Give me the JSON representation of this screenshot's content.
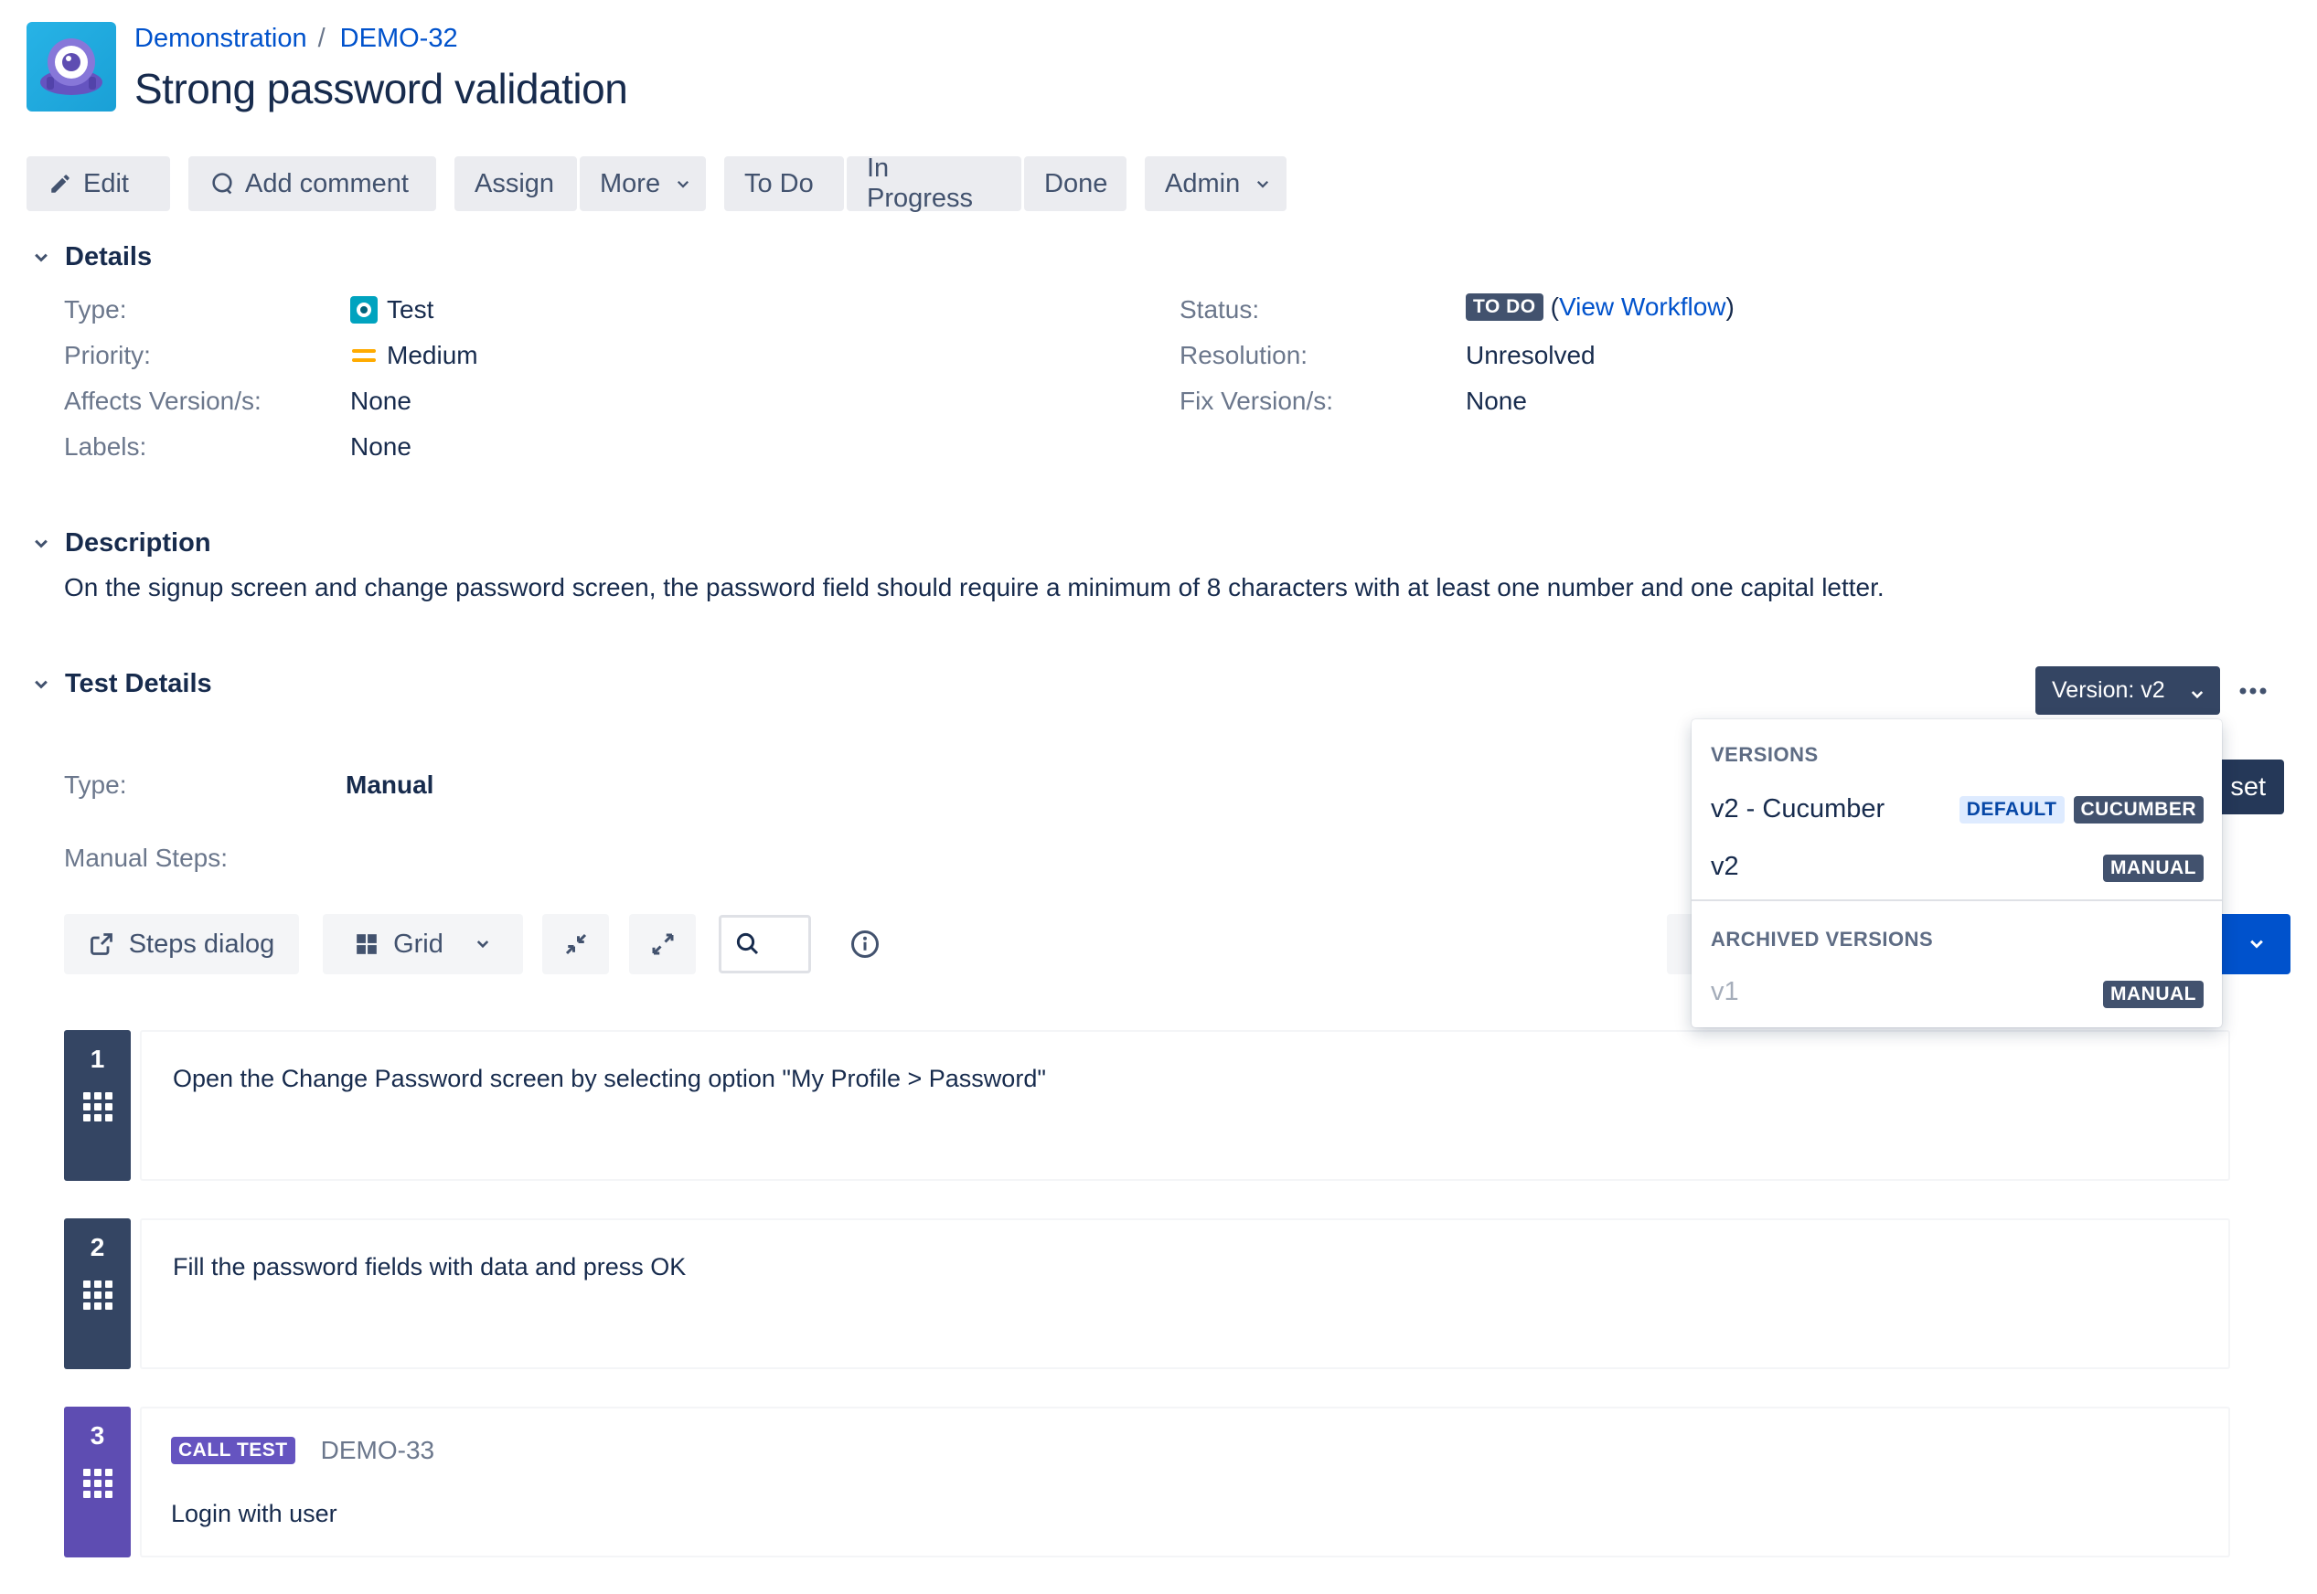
{
  "breadcrumb": {
    "project": "Demonstration",
    "separator": "/",
    "issue_key": "DEMO-32"
  },
  "title": "Strong password validation",
  "toolbar": {
    "edit": "Edit",
    "add_comment": "Add comment",
    "assign": "Assign",
    "more": "More",
    "to_do": "To Do",
    "in_progress": "In Progress",
    "done": "Done",
    "admin": "Admin"
  },
  "details": {
    "heading": "Details",
    "type_label": "Type:",
    "type_value": "Test",
    "priority_label": "Priority:",
    "priority_value": "Medium",
    "affects_label": "Affects Version/s:",
    "affects_value": "None",
    "labels_label": "Labels:",
    "labels_value": "None",
    "status_label": "Status:",
    "status_value": "TO DO",
    "workflow_open": "(",
    "workflow_link": "View Workflow",
    "workflow_close": ")",
    "resolution_label": "Resolution:",
    "resolution_value": "Unresolved",
    "fix_label": "Fix Version/s:",
    "fix_value": "None"
  },
  "description": {
    "heading": "Description",
    "text": "On the signup screen and change password screen, the password field should require a minimum of 8 characters with at least one number and one capital letter."
  },
  "test_details": {
    "heading": "Test Details",
    "version_button": "Version: v2",
    "type_label": "Type:",
    "type_value": "Manual",
    "manual_steps_label": "Manual Steps:",
    "reset_partial": "set",
    "steps_dialog": "Steps dialog",
    "grid": "Grid"
  },
  "versions_dropdown": {
    "versions_heading": "VERSIONS",
    "items": [
      {
        "label": "v2 - Cucumber",
        "badges": [
          "DEFAULT",
          "CUCUMBER"
        ]
      },
      {
        "label": "v2",
        "badges": [
          "MANUAL"
        ]
      }
    ],
    "archived_heading": "ARCHIVED VERSIONS",
    "archived": [
      {
        "label": "v1",
        "badges": [
          "MANUAL"
        ]
      }
    ]
  },
  "steps": [
    {
      "number": "1",
      "text": "Open the Change Password screen by selecting option \"My Profile > Password\""
    },
    {
      "number": "2",
      "text": "Fill the password fields with data and press OK"
    },
    {
      "number": "3",
      "badge": "CALL TEST",
      "key": "DEMO-33",
      "text": "Login with user"
    }
  ],
  "colors": {
    "primary_blue": "#0052cc",
    "dark_navy": "#344563",
    "purple": "#5e4db2",
    "priority_orange": "#ffab00"
  }
}
